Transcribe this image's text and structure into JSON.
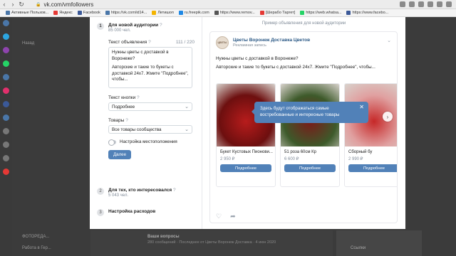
{
  "browser": {
    "url": "vk.com/vmfollowers",
    "bookmarks": [
      {
        "label": "Активные Пользов...",
        "color": "#4a76a8"
      },
      {
        "label": "Яндекс",
        "color": "#e53935"
      },
      {
        "label": "Facebook",
        "color": "#3b5998"
      },
      {
        "label": "https://vk.com/id14...",
        "color": "#4a76a8"
      },
      {
        "label": "Летишоп",
        "color": "#f4b400"
      },
      {
        "label": "ru.freepik.com",
        "color": "#1e88e5"
      },
      {
        "label": "https://www.remov...",
        "color": "#555555"
      },
      {
        "label": "[Шерабо Таргет]",
        "color": "#e53935"
      },
      {
        "label": "https://web.whatsa...",
        "color": "#25d366"
      },
      {
        "label": "https://www.facebo...",
        "color": "#3b5998"
      }
    ]
  },
  "sidebar": {
    "app_icon_colors": [
      "#4a76a8",
      "#2ca5e0",
      "#8e44ad",
      "#25d366",
      "#4a76a8",
      "#e1306c",
      "#3b5998",
      "#4a76a8",
      "#777777",
      "#777777",
      "#777777",
      "#e53935"
    ]
  },
  "background": {
    "links": [
      {
        "label": "Назад"
      },
      {
        "label": "ФОТОРЕДА..."
      },
      {
        "label": "Работа в Гер..."
      }
    ],
    "bottom_title": "Ваши вопросы",
    "bottom_text": "280 сообщений · Последнее от Цветы Воронеж Доставка · 4 июн 2020",
    "links_label": "Ссылки"
  },
  "settings": {
    "step1": {
      "number": "1",
      "title": "Для новой аудитории",
      "sub": "85 000 чел."
    },
    "ad_text": {
      "label": "Текст объявления",
      "counter": "111 / 220",
      "lines": [
        "Нужны цветы с доставкой в Воронеже?",
        "Авторские и такие то букеты с доставкой 24х7. Жмите \"Подробнее\", чтобы..."
      ]
    },
    "button_text": {
      "label": "Текст кнопки",
      "value": "Подробнее"
    },
    "goods": {
      "label": "Товары",
      "value": "Все товары сообщества"
    },
    "location_toggle": "Настройка местоположения",
    "next_button": "Далее",
    "step2": {
      "number": "2",
      "title": "Для тех, кто интересовался",
      "sub": "5 043 чел."
    },
    "step3": {
      "number": "3",
      "title": "Настройка расходов"
    }
  },
  "preview": {
    "header": "Пример объявления для новой аудитории",
    "community_name": "Цветы Воронеж Доставка Цветов",
    "community_sub": "Рекламная запись",
    "logo_text": "ЦВЕТЫ",
    "text_line1": "Нужны цветы с доставкой в Воронеже?",
    "text_line2": "Авторские и такие то букеты с доставкой 24х7. Жмите \"Подробнее\", чтобы...",
    "tooltip": "Здесь будут отображаться самые востребованные и интересные товары",
    "products": [
      {
        "name": "Букет Кустовых Пионови...",
        "price": "2 950 ₽",
        "button": "Подробнее",
        "img_color": "#b71c1c",
        "img_color2": "#6d0f0f"
      },
      {
        "name": "51 роза 60см Кр",
        "price": "6 600 ₽",
        "button": "Подробнее",
        "img_color": "#7a1a1a",
        "img_color2": "#3d5a2a"
      },
      {
        "name": "Сборный бу",
        "price": "2 990 ₽",
        "button": "Подробнее",
        "img_color": "#c62828",
        "img_color2": "#e0a0a0"
      }
    ]
  }
}
